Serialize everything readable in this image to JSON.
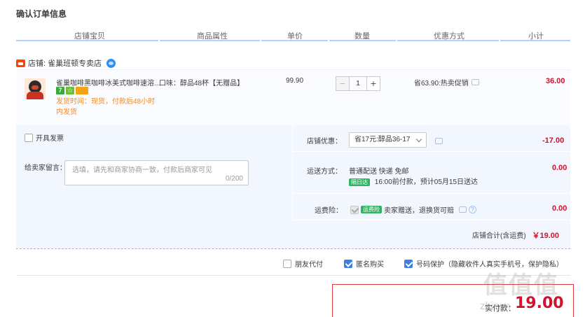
{
  "section_title": "确认订单信息",
  "columns": [
    "店铺宝贝",
    "商品属性",
    "单价",
    "数量",
    "优惠方式",
    "小计"
  ],
  "shop": {
    "name": "店铺: 雀巢班顿专卖店"
  },
  "item": {
    "name": "雀巢咖啡黑咖啡冰美式咖啡速溶...",
    "badges": [
      "7",
      "☆",
      ""
    ],
    "ship_time": "发货时间：现货，付款后48小时内发货",
    "attr": "口味：醇品48杯【无赠品】",
    "price": "99.90",
    "qty": "1",
    "promo": "省63.90:热卖促销",
    "subtotal": "36.00"
  },
  "invoice": {
    "label": "开具发票",
    "checked": false
  },
  "message": {
    "label": "给卖家留言：",
    "placeholder": "选填，请先和商家协商一致，付款后商家可见",
    "count": "0/200"
  },
  "shop_discount": {
    "label": "店铺优惠：",
    "selected": "省17元:醇品36-17",
    "amount": "-17.00"
  },
  "shipping": {
    "label": "运送方式：",
    "method": "普通配送 快递 免邮",
    "tag": "隔日达",
    "eta": "16:00前付款，预计05月15日送达",
    "amount": "0.00"
  },
  "insurance": {
    "label": "运费险：",
    "tag": "运费险",
    "desc": "卖家赠送，退换货可赔",
    "amount": "0.00"
  },
  "shop_total": {
    "label": "店铺合计(含运费)",
    "amount": "￥19.00"
  },
  "footer": {
    "friend_pay": {
      "label": "朋友代付",
      "checked": false
    },
    "anonymous": {
      "label": "匿名购买",
      "checked": true
    },
    "number_protect": {
      "label": "号码保护（隐藏收件人真实手机号，保护隐私）",
      "checked": true
    }
  },
  "payment": {
    "label": "实付款：",
    "amount": "19.00"
  },
  "watermark": "值值值",
  "watermark_url": "zhi.ym"
}
